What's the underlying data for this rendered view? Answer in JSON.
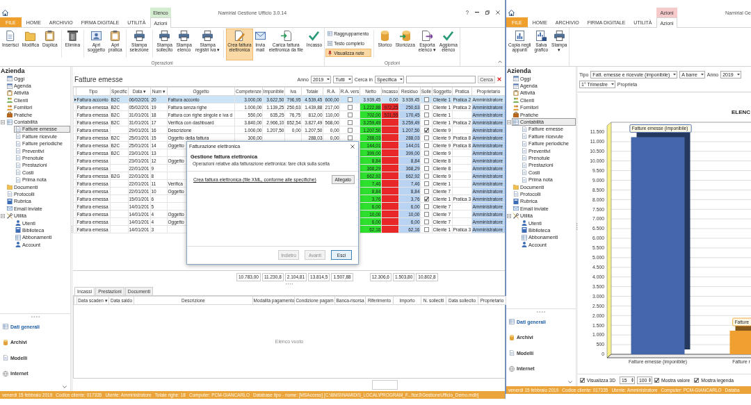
{
  "windows": [
    {
      "title": "Namirial Gestione Ufficio 3.0.14",
      "tabs": [
        {
          "label": "FILE",
          "kind": "file",
          "selected": false
        },
        {
          "label": "HOME",
          "kind": "tab",
          "selected": false
        },
        {
          "label": "ARCHIVIO",
          "kind": "tab",
          "selected": false
        },
        {
          "label": "FIRMA DIGITALE",
          "kind": "tab",
          "selected": false
        },
        {
          "label": "UTILITÀ",
          "kind": "tab",
          "selected": false
        },
        {
          "label": "Azioni",
          "kind": "tab",
          "selected": true,
          "context": {
            "label": "Elenco",
            "color": "#d4ecd0"
          }
        }
      ],
      "ribbon": {
        "groups": [
          {
            "label": "Operazioni",
            "clusters": [
              {
                "kind": "large",
                "buttons": [
                  {
                    "label": "Inserisci",
                    "selected": false
                  },
                  {
                    "label": "Modifica",
                    "selected": false
                  },
                  {
                    "label": "Duplica",
                    "selected": false
                  }
                ]
              },
              {
                "kind": "large",
                "buttons": [
                  {
                    "label": "Elimina",
                    "selected": false
                  }
                ]
              },
              {
                "kind": "large",
                "buttons": [
                  {
                    "label": "Apri\nsoggetto",
                    "selected": false
                  },
                  {
                    "label": "Apri\npratica",
                    "selected": false
                  }
                ]
              },
              {
                "kind": "large",
                "buttons": [
                  {
                    "label": "Stampa\nselezione",
                    "selected": false
                  }
                ]
              },
              {
                "kind": "large",
                "buttons": [
                  {
                    "label": "Stampa\nsollecito",
                    "selected": false
                  },
                  {
                    "label": "Stampa\nelenco",
                    "selected": false
                  },
                  {
                    "label": "Stampa\nregistri iva ▾",
                    "selected": false
                  }
                ]
              },
              {
                "kind": "large",
                "buttons": [
                  {
                    "label": "Crea fattura\nelettronica",
                    "selected": true
                  },
                  {
                    "label": "Invia\nmail",
                    "selected": false
                  },
                  {
                    "label": "Carica fattura\nelettronica da file",
                    "selected": false
                  },
                  {
                    "label": "Incasso",
                    "selected": false
                  }
                ]
              }
            ]
          },
          {
            "label": "Opzioni",
            "clusters": [
              {
                "kind": "small",
                "buttons": [
                  {
                    "label": "Raggruppamento",
                    "selected": false
                  },
                  {
                    "label": "Testo completo",
                    "selected": false
                  },
                  {
                    "label": "Visualizza note",
                    "selected": true
                  }
                ]
              },
              {
                "kind": "large",
                "buttons": [
                  {
                    "label": "Storico",
                    "selected": false
                  },
                  {
                    "label": "Storicizza",
                    "selected": false
                  },
                  {
                    "label": "Esporta\nelenco ▾",
                    "selected": false
                  },
                  {
                    "label": "Aggiorna\nelenco",
                    "selected": false
                  }
                ]
              }
            ]
          }
        ]
      },
      "sidebar": {
        "heading": "Azienda",
        "tree": [
          {
            "label": "Oggi",
            "selected": false
          },
          {
            "label": "Agenda",
            "selected": false
          },
          {
            "label": "Attività",
            "selected": false
          },
          {
            "label": "Clienti",
            "selected": false
          },
          {
            "label": "Fornitori",
            "selected": false
          },
          {
            "label": "Pratiche",
            "selected": false
          },
          {
            "label": "Contabilità",
            "selected": false,
            "expanded": true,
            "children": [
              {
                "label": "Fatture emesse",
                "selected": true
              },
              {
                "label": "Fatture ricevute",
                "selected": false
              },
              {
                "label": "Fatture periodiche",
                "selected": false
              },
              {
                "label": "Preventivi",
                "selected": false
              },
              {
                "label": "Prenotule",
                "selected": false
              },
              {
                "label": "Prestazioni",
                "selected": false
              },
              {
                "label": "Costi",
                "selected": false
              },
              {
                "label": "Prima nota",
                "selected": false
              }
            ]
          },
          {
            "label": "Documenti",
            "selected": false
          },
          {
            "label": "Protocolli",
            "selected": false
          },
          {
            "label": "Rubrica",
            "selected": false
          },
          {
            "label": "Email inviate",
            "selected": false
          },
          {
            "label": "Utilità",
            "selected": false,
            "expanded": true,
            "children": [
              {
                "label": "Utenti",
                "selected": false
              },
              {
                "label": "Biblioteca",
                "selected": false
              },
              {
                "label": "Abbonamenti",
                "selected": false
              },
              {
                "label": "Account",
                "selected": false
              }
            ]
          }
        ],
        "nav": [
          {
            "label": "Dati generali",
            "selected": true
          },
          {
            "label": "Archivi",
            "selected": false
          },
          {
            "label": "Modelli",
            "selected": false
          },
          {
            "label": "Internet",
            "selected": false
          }
        ]
      },
      "main": {
        "kind": "invoice_list",
        "title": "Fatture emesse",
        "filters": [
          {
            "kind": "label",
            "text": "Anno"
          },
          {
            "kind": "select",
            "value": "2019"
          },
          {
            "kind": "select",
            "value": "Tutti"
          },
          {
            "kind": "label",
            "text": "Cerca in"
          },
          {
            "kind": "select",
            "value": "Specifica"
          },
          {
            "kind": "search",
            "button": "Cerca"
          }
        ],
        "table": {
          "columns": [
            {
              "label": "Tipo",
              "kind": "text"
            },
            {
              "label": "Specific",
              "kind": "text"
            },
            {
              "label": "Data ▾",
              "kind": "text"
            },
            {
              "label": "Num ▾",
              "kind": "text"
            },
            {
              "label": "Oggetto",
              "kind": "text"
            },
            {
              "label": "Competenze",
              "kind": "number",
              "total": "10.783,00"
            },
            {
              "label": "Imponibile",
              "kind": "number",
              "total": "11.230,8"
            },
            {
              "label": "Iva",
              "kind": "number",
              "total": "2.104,81"
            },
            {
              "label": "Totale",
              "kind": "number",
              "total": "13.814,5"
            },
            {
              "label": "R.A.",
              "kind": "number",
              "total": "1.507,88"
            },
            {
              "label": "R.A. vers",
              "kind": "check"
            },
            {
              "label": "Netto",
              "kind": "number",
              "color": "#2ee02e",
              "total": "12.306,6"
            },
            {
              "label": "Incasso",
              "kind": "number",
              "color": "#e82828",
              "total": "1.503,80"
            },
            {
              "label": "Residuo",
              "kind": "number",
              "color": "#b9d3f2",
              "total": "10.802,8"
            },
            {
              "label": "Solle",
              "kind": "check"
            },
            {
              "label": "Soggetto",
              "kind": "text"
            },
            {
              "label": "Pratica",
              "kind": "text"
            },
            {
              "label": "Proprietario",
              "kind": "text",
              "color": "#b9d3f2"
            }
          ],
          "rows": [
            {
              "selected": true,
              "cells": [
                "Fattura acconto",
                "B2C",
                "06/02/201",
                "20",
                "Fattura acconto",
                "3.000,00",
                "3.622,50",
                "796,95",
                "4.539,45",
                "600,00",
                false,
                "3.939,45",
                "0,00",
                "3.939,45",
                false,
                "Cliente 1",
                "Pratica 2",
                "Amministratore"
              ]
            },
            {
              "selected": false,
              "cells": [
                "Fattura emessa",
                "B2C",
                "05/02/201",
                "19",
                "Fattura senza righe",
                "1.000,00",
                "1.139,25",
                "250,63",
                "1.439,88",
                "217,00",
                false,
                "1.222,88",
                "972,25",
                "250,63",
                false,
                "Cliente 1",
                "Pratica 2",
                "Amministratore"
              ]
            },
            {
              "selected": false,
              "cells": [
                "Fattura emessa",
                "B2C",
                "31/01/201",
                "18",
                "Fattura con righe singole e iva d",
                "550,00",
                "635,25",
                "76,75",
                "812,00",
                "110,00",
                false,
                "702,00",
                "531,55",
                "170,45",
                false,
                "Cliente 1",
                null,
                "Amministratore"
              ]
            },
            {
              "selected": false,
              "cells": [
                "Fattura emessa",
                "B2C",
                "31/01/201",
                "17",
                "Verifica con dashboard",
                "3.840,00",
                "2.966,10",
                "652,54",
                "3.827,49",
                "568,00",
                false,
                "3.259,49",
                null,
                "3.259,49",
                false,
                "Cliente 1",
                "Pratica 2",
                "Amministratore"
              ]
            },
            {
              "selected": false,
              "cells": [
                "Fattura emessa",
                null,
                "29/01/201",
                "16",
                "Descrizione",
                "1.000,00",
                "1.207,50",
                "0,00",
                "1.207,50",
                "0,00",
                false,
                "1.207,50",
                null,
                "1.207,50",
                true,
                "Cliente 9",
                null,
                "Amministratore"
              ]
            },
            {
              "selected": false,
              "cells": [
                "Fattura emessa",
                "B2C",
                "25/01/201",
                "15",
                "Oggetto della fattura",
                "300,00",
                null,
                null,
                "288,03",
                "0,00",
                false,
                "288,03",
                null,
                "288,03",
                false,
                "Cliente 9",
                "Pratica 8",
                "Amministratore"
              ]
            },
            {
              "selected": false,
              "cells": [
                "Fattura emessa",
                "B2C",
                "25/01/201",
                "14",
                "Oggetto",
                null,
                null,
                null,
                null,
                null,
                null,
                "144,01",
                null,
                "144,01",
                false,
                "Cliente 9",
                "Pratica 8",
                "Amministratore"
              ]
            },
            {
              "selected": false,
              "cells": [
                "Fattura emessa",
                "B2C",
                "23/01/201",
                "13",
                null,
                null,
                null,
                null,
                null,
                null,
                null,
                "399,00",
                null,
                "399,00",
                false,
                "Cliente 9",
                null,
                "Amministratore"
              ]
            },
            {
              "selected": false,
              "cells": [
                "Fattura emessa",
                null,
                "23/01/201",
                "12",
                "Oggetto",
                null,
                null,
                null,
                null,
                null,
                null,
                "8,84",
                null,
                "8,84",
                false,
                "Cliente 8",
                null,
                "Amministratore"
              ]
            },
            {
              "selected": false,
              "cells": [
                "Fattura emessa",
                null,
                "22/01/201",
                "9",
                null,
                null,
                null,
                null,
                null,
                null,
                null,
                "368,29",
                null,
                "368,29",
                false,
                "Cliente 8",
                null,
                "Amministratore"
              ]
            },
            {
              "selected": false,
              "cells": [
                "Fattura emessa",
                "B2G",
                "22/01/201",
                "8",
                null,
                null,
                null,
                null,
                null,
                null,
                null,
                "662,92",
                null,
                "662,92",
                false,
                "Cliente 9",
                null,
                "Amministratore"
              ]
            },
            {
              "selected": false,
              "cells": [
                "Fattura emessa",
                null,
                "22/01/201",
                "11",
                "Verifica",
                null,
                null,
                null,
                null,
                null,
                null,
                "7,46",
                null,
                "7,46",
                false,
                "Cliente 1",
                null,
                "Amministratore"
              ]
            },
            {
              "selected": false,
              "cells": [
                "Fattura emessa",
                null,
                "22/01/201",
                "10",
                "Oggetto",
                null,
                null,
                null,
                null,
                null,
                null,
                "8,84",
                null,
                "8,84",
                false,
                "Cliente 7",
                null,
                "Amministratore"
              ]
            },
            {
              "selected": false,
              "cells": [
                "Fattura emessa",
                null,
                "15/01/201",
                "6",
                null,
                null,
                null,
                null,
                null,
                null,
                null,
                "3,76",
                null,
                "3,76",
                true,
                "Cliente 1",
                "Pratica 3",
                "Amministratore"
              ]
            },
            {
              "selected": false,
              "cells": [
                "Fattura emessa",
                null,
                "14/01/201",
                "5",
                null,
                null,
                null,
                null,
                null,
                null,
                null,
                "6,00",
                null,
                "6,00",
                false,
                "Cliente 7",
                null,
                "Amministratore"
              ]
            },
            {
              "selected": false,
              "cells": [
                "Fattura emessa",
                null,
                "14/01/201",
                "4",
                "Oggetto",
                null,
                null,
                null,
                null,
                null,
                null,
                "10,00",
                null,
                "10,00",
                false,
                "Cliente 7",
                null,
                "Amministratore"
              ]
            },
            {
              "selected": false,
              "cells": [
                "Fattura emessa",
                null,
                "14/01/201",
                "4",
                "Oggetto",
                null,
                null,
                null,
                null,
                null,
                null,
                "6,00",
                null,
                "6,00",
                false,
                "Cliente 7",
                null,
                "Amministratore"
              ]
            },
            {
              "selected": false,
              "cells": [
                "Fattura emessa",
                null,
                "14/01/201",
                "3",
                null,
                null,
                null,
                null,
                null,
                null,
                null,
                "62,16",
                null,
                "62,16",
                false,
                "Cliente 1",
                "Pratica 3",
                "Amministratore"
              ]
            }
          ]
        },
        "dialog": {
          "title": "Fatturazione elettronica",
          "heading": "Gestione fattura elettronica",
          "description": "Operazioni relative alla fatturazione elettronica: fare click sulla scelta",
          "actions": [
            {
              "label": "Crea fattura elettronica (file XML, conforme alle specifiche)",
              "button": "Allegato"
            }
          ],
          "buttons": [
            {
              "label": "Indietro",
              "disabled": true,
              "focused": false
            },
            {
              "label": "Avanti",
              "disabled": true,
              "focused": false
            },
            {
              "label": "Esci",
              "disabled": false,
              "focused": true
            }
          ]
        },
        "detail": {
          "tabs": [
            {
              "label": "Incassi",
              "selected": true
            },
            {
              "label": "Prestazioni",
              "selected": false
            },
            {
              "label": "Documenti",
              "selected": false
            }
          ],
          "columns": [
            "Data scaden ▾",
            "Data saldo",
            "Descrizione",
            "Modalità pagamento",
            "Condizione pagam",
            "Banca-risorsa",
            "Riferimento",
            "Importo",
            "N. solleciti",
            "Data sollecito",
            "Proprietario"
          ],
          "empty_text": "Elenco vuoto"
        }
      },
      "status_bar": [
        "venerdì 15 febbraio 2019",
        "Codice cliente: 017335",
        "Utente: Amministratore",
        "Totale righe: 18",
        "Computer: PCM-GIANCARLO",
        "Database tipo - nome: [MSAccess] [C:\\BMS\\NAMIDIS_LOCAL\\PROGRAM_F...fice3\\GestioneUfficio_Demo.mdb]"
      ]
    },
    {
      "title": "Namirial Ge",
      "tabs": [
        {
          "label": "FILE",
          "kind": "file",
          "selected": false
        },
        {
          "label": "HOME",
          "kind": "tab",
          "selected": false
        },
        {
          "label": "ARCHIVIO",
          "kind": "tab",
          "selected": false
        },
        {
          "label": "FIRMA DIGITALE",
          "kind": "tab",
          "selected": false
        },
        {
          "label": "UTILITÀ",
          "kind": "tab",
          "selected": false
        },
        {
          "label": "Azioni",
          "kind": "tab",
          "selected": true,
          "context": {
            "label": "Azioni",
            "color": "#f6c9cb"
          }
        }
      ],
      "ribbon": {
        "groups": [
          {
            "clusters": [
              {
                "kind": "large",
                "buttons": [
                  {
                    "label": "Copia negli\nappunti",
                    "selected": false
                  },
                  {
                    "label": "Salva\ngrafico",
                    "selected": false
                  },
                  {
                    "label": "Stampa\n▾",
                    "selected": false
                  }
                ]
              }
            ]
          }
        ]
      },
      "sidebar": {
        "heading": "Azienda",
        "tree": [
          {
            "label": "Oggi",
            "selected": false
          },
          {
            "label": "Agenda",
            "selected": false
          },
          {
            "label": "Attività",
            "selected": false
          },
          {
            "label": "Clienti",
            "selected": false
          },
          {
            "label": "Fornitori",
            "selected": false
          },
          {
            "label": "Pratiche",
            "selected": false
          },
          {
            "label": "Contabilità",
            "selected": true,
            "expanded": true,
            "children": [
              {
                "label": "Fatture emesse",
                "selected": false
              },
              {
                "label": "Fatture ricevute",
                "selected": false
              },
              {
                "label": "Fatture periodiche",
                "selected": false
              },
              {
                "label": "Preventivi",
                "selected": false
              },
              {
                "label": "Prenotule",
                "selected": false
              },
              {
                "label": "Prestazioni",
                "selected": false
              },
              {
                "label": "Costi",
                "selected": false
              },
              {
                "label": "Prima nota",
                "selected": false
              }
            ]
          },
          {
            "label": "Documenti",
            "selected": false
          },
          {
            "label": "Protocolli",
            "selected": false
          },
          {
            "label": "Rubrica",
            "selected": false
          },
          {
            "label": "Email inviate",
            "selected": false
          },
          {
            "label": "Utilità",
            "selected": false,
            "expanded": true,
            "children": [
              {
                "label": "Utenti",
                "selected": false
              },
              {
                "label": "Biblioteca",
                "selected": false
              },
              {
                "label": "Abbonamenti",
                "selected": false
              },
              {
                "label": "Account",
                "selected": false
              }
            ]
          }
        ],
        "nav": [
          {
            "label": "Dati generali",
            "selected": true
          },
          {
            "label": "Archivi",
            "selected": false
          },
          {
            "label": "Modelli",
            "selected": false
          },
          {
            "label": "Internet",
            "selected": false
          }
        ]
      },
      "main": {
        "kind": "chart_view",
        "filters": [
          {
            "kind": "label",
            "text": "Tipo"
          },
          {
            "kind": "select",
            "value": "Fatt. emesse e ricevute (imponibile)"
          },
          {
            "kind": "select",
            "value": "A barre"
          },
          {
            "kind": "label",
            "text": "Anno"
          },
          {
            "kind": "select",
            "value": "2019"
          },
          {
            "kind": "select",
            "value": "1° Trimestre"
          },
          {
            "kind": "label",
            "text": "Proprieta"
          }
        ],
        "chart_data": {
          "type": "bar",
          "title": "ELENC",
          "categories": [
            "Fatture emesse (imponibile)",
            "Fatture r"
          ],
          "series": [
            {
              "name": "Fatture emesse (imponibile)",
              "color": "#4466aa",
              "values": [
                11230,
                null
              ]
            },
            {
              "name": "Fatture",
              "color": "#f0a030",
              "values": [
                null,
                1220
              ]
            }
          ],
          "ylim": [
            0,
            12000
          ],
          "grid": true,
          "yticks": [
            {
              "value": 0,
              "label": "0"
            },
            {
              "value": 500,
              "label": "500"
            },
            {
              "value": 1000,
              "label": "1.000"
            },
            {
              "value": 1500,
              "label": "1.500"
            },
            {
              "value": 2000,
              "label": "2.000"
            },
            {
              "value": 2500,
              "label": "2.500"
            },
            {
              "value": 3000,
              "label": "3.000"
            },
            {
              "value": 3500,
              "label": "3.500"
            },
            {
              "value": 4000,
              "label": "4.000"
            },
            {
              "value": 4500,
              "label": "4.500"
            },
            {
              "value": 5000,
              "label": "5.000"
            },
            {
              "value": 5500,
              "label": "5.500"
            },
            {
              "value": 6000,
              "label": "6.000"
            },
            {
              "value": 6500,
              "label": "6.500"
            },
            {
              "value": 7000,
              "label": "7.000"
            },
            {
              "value": 7500,
              "label": "7.500"
            },
            {
              "value": 8000,
              "label": "8.000"
            },
            {
              "value": 8500,
              "label": "8.500"
            },
            {
              "value": 9000,
              "label": "9.000"
            },
            {
              "value": 9500,
              "label": "9.500"
            },
            {
              "value": 10000,
              "label": "10.000"
            },
            {
              "value": 10500,
              "label": "10.500"
            },
            {
              "value": 11000,
              "label": "11.000"
            },
            {
              "value": 11500,
              "label": "11.500"
            }
          ]
        },
        "options": [
          {
            "kind": "check",
            "label": "Visualizza 3D",
            "checked": true
          },
          {
            "kind": "spin",
            "value": "15"
          },
          {
            "kind": "spin",
            "value": "100"
          },
          {
            "kind": "check",
            "label": "Mostra valore",
            "checked": true
          },
          {
            "kind": "check",
            "label": "Mostra legenda",
            "checked": true
          }
        ]
      },
      "status_bar": [
        "venerdì 15 febbraio 2019",
        "Codice cliente: 017335",
        "Utente: Amministratore",
        "Computer: PCM-GIANCARLO",
        "Databa"
      ]
    }
  ]
}
